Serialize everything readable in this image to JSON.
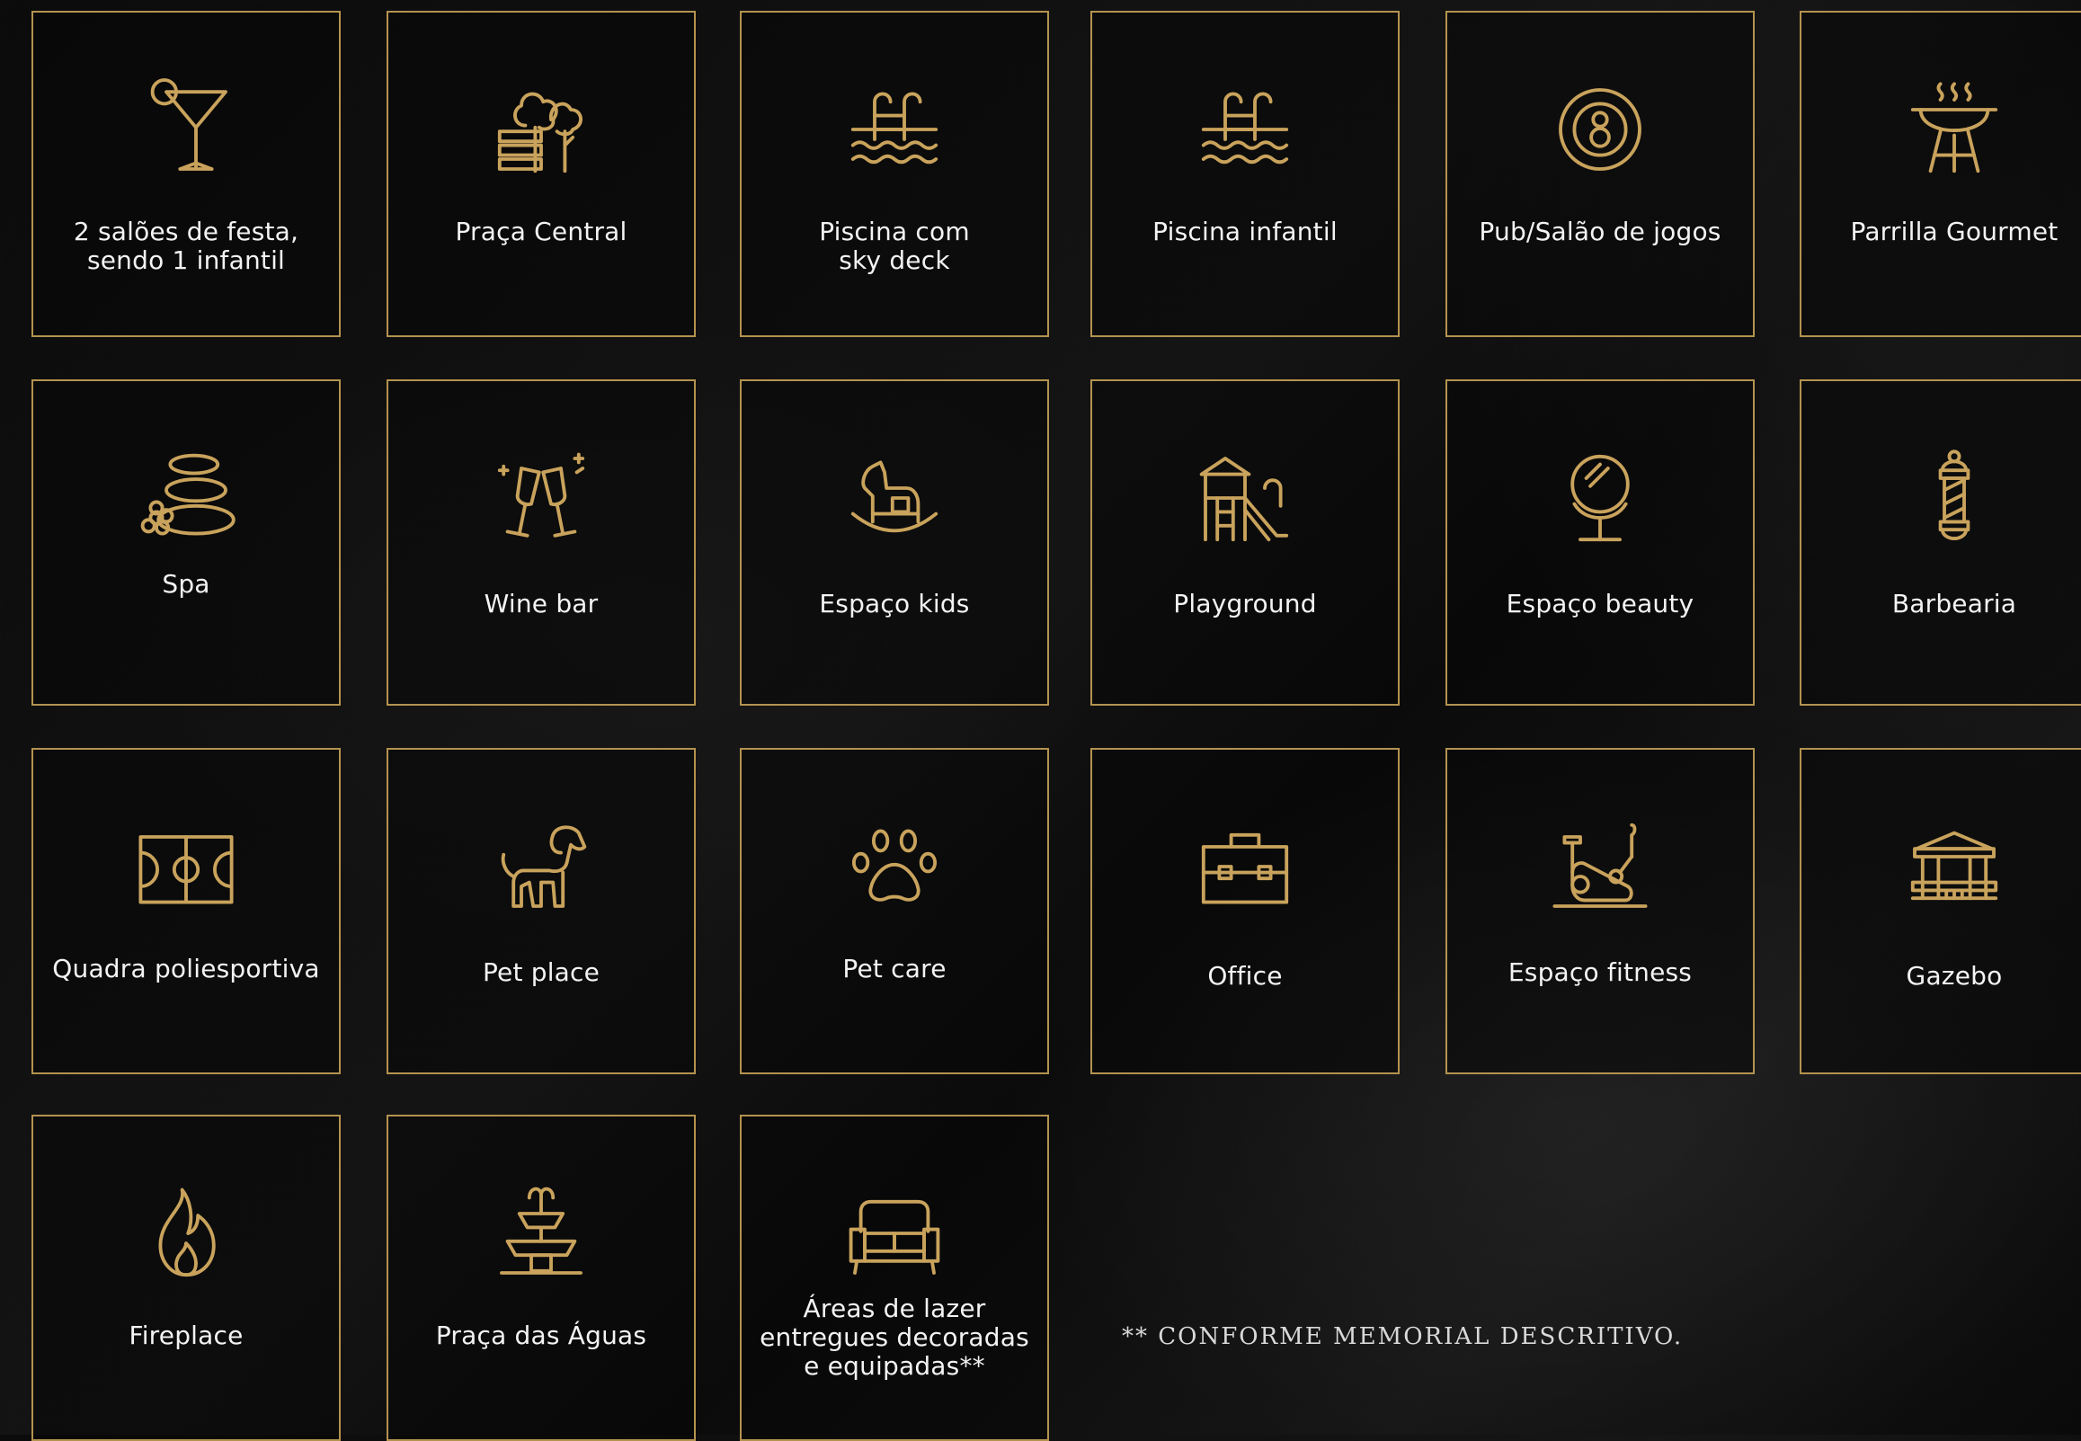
{
  "amenities": [
    {
      "label": "2 salões de festa,\nsendo 1 infantil",
      "icon": "cocktail-icon"
    },
    {
      "label": "Praça Central",
      "icon": "park-bench-icon"
    },
    {
      "label": "Piscina com\nsky deck",
      "icon": "pool-ladder-icon"
    },
    {
      "label": "Piscina infantil",
      "icon": "pool-ladder-icon"
    },
    {
      "label": "Pub/Salão de jogos",
      "icon": "billiard-ball-icon"
    },
    {
      "label": "Parrilla Gourmet",
      "icon": "barbecue-grill-icon"
    },
    {
      "label": "Spa",
      "icon": "spa-stones-icon"
    },
    {
      "label": "Wine bar",
      "icon": "wine-glasses-icon"
    },
    {
      "label": "Espaço kids",
      "icon": "rocking-horse-icon"
    },
    {
      "label": "Playground",
      "icon": "playground-slide-icon"
    },
    {
      "label": "Espaço beauty",
      "icon": "vanity-mirror-icon"
    },
    {
      "label": "Barbearia",
      "icon": "barber-pole-icon"
    },
    {
      "label": "Quadra poliesportiva",
      "icon": "sports-court-icon"
    },
    {
      "label": "Pet place",
      "icon": "dog-icon"
    },
    {
      "label": "Pet care",
      "icon": "paw-icon"
    },
    {
      "label": "Office",
      "icon": "briefcase-icon"
    },
    {
      "label": "Espaço fitness",
      "icon": "exercise-bike-icon"
    },
    {
      "label": "Gazebo",
      "icon": "gazebo-icon"
    },
    {
      "label": "Fireplace",
      "icon": "flame-icon"
    },
    {
      "label": "Praça das Águas",
      "icon": "fountain-icon"
    },
    {
      "label": "Áreas de lazer\nentregues decoradas\ne equipadas**",
      "icon": "sofa-icon"
    }
  ],
  "footnote": "** CONFORME MEMORIAL DESCRITIVO.",
  "colors": {
    "accent": "#c9a35c",
    "border": "#b4934f",
    "text": "#f3f3f3",
    "background": "#0a0a0a"
  }
}
